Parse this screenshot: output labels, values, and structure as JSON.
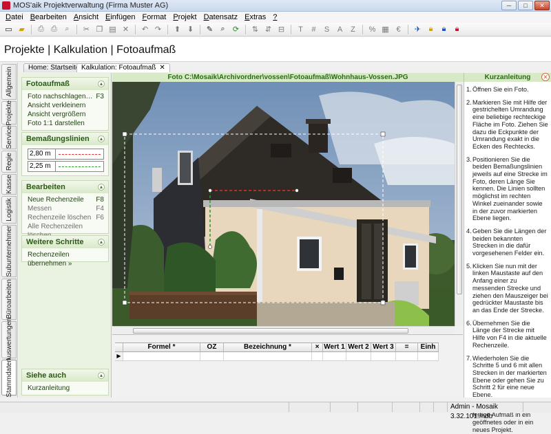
{
  "window": {
    "title": "MOS'aik Projektverwaltung (Firma Muster AG)"
  },
  "menu": [
    {
      "label": "Datei",
      "u": "D",
      "rest": "atei"
    },
    {
      "label": "Bearbeiten",
      "u": "B",
      "rest": "earbeiten"
    },
    {
      "label": "Ansicht",
      "u": "A",
      "rest": "nsicht"
    },
    {
      "label": "Einfügen",
      "u": "E",
      "rest": "infügen"
    },
    {
      "label": "Format",
      "u": "F",
      "rest": "ormat"
    },
    {
      "label": "Projekt",
      "u": "P",
      "rest": "rojekt"
    },
    {
      "label": "Datensatz",
      "u": "D",
      "rest": "atensatz"
    },
    {
      "label": "Extras",
      "u": "E",
      "rest": "xtras"
    },
    {
      "label": "?",
      "u": "?",
      "rest": ""
    }
  ],
  "header": {
    "title": "Projekte | Kalkulation | Fotoaufmaß"
  },
  "vtabs": [
    "Allgemein",
    "Projekte",
    "Service",
    "Regie",
    "Kasse",
    "Logistik",
    "Subunternehmer",
    "Büroarbeiten",
    "Auswertungen",
    "Stammdaten"
  ],
  "doc_tabs": [
    "Home: Startseite",
    "Kalkulation: Fotoaufmaß"
  ],
  "panels": {
    "fotoaufmass": {
      "title": "Fotoaufmaß",
      "items": [
        {
          "label": "Foto nachschlagen…",
          "key": "F3"
        },
        {
          "label": "Ansicht verkleinern",
          "key": ""
        },
        {
          "label": "Ansicht vergrößern",
          "key": ""
        },
        {
          "label": "Foto 1:1 darstellen",
          "key": ""
        }
      ]
    },
    "bemassung": {
      "title": "Bemaßungslinien",
      "lines": [
        {
          "value": "2,80 m",
          "color": "#e0302a"
        },
        {
          "value": "2,25 m",
          "color": "#2a9a2a"
        }
      ]
    },
    "bearbeiten": {
      "title": "Bearbeiten",
      "items": [
        {
          "label": "Neue Rechenzeile",
          "key": "F8",
          "enabled": true
        },
        {
          "label": "Messen",
          "key": "F4",
          "enabled": false
        },
        {
          "label": "Rechenzeile löschen",
          "key": "F6",
          "enabled": false
        },
        {
          "label": "Alle Rechenzeilen löschen",
          "key": "",
          "enabled": false
        }
      ]
    },
    "weitere": {
      "title": "Weitere Schritte",
      "items": [
        {
          "label": "Rechenzeilen übernehmen »",
          "key": ""
        }
      ]
    },
    "siehe": {
      "title": "Siehe auch",
      "items": [
        {
          "label": "Kurzanleitung",
          "key": ""
        }
      ]
    }
  },
  "photo": {
    "title": "Foto C:\\Mosaik\\Archivordner\\vossen\\Fotoaufmaß\\Wohnhaus-Vossen.JPG"
  },
  "grid": {
    "columns": [
      "Formel *",
      "OZ",
      "Bezeichnung *",
      "×",
      "Wert 1",
      "Wert 2",
      "Wert 3",
      "=",
      "Einh"
    ]
  },
  "kurzanleitung": {
    "title": "Kurzanleitung",
    "steps": [
      "Öffnen Sie ein Foto.",
      "Markieren Sie mit Hilfe der gestrichelten Umrandung eine beliebige rechteckige Fläche im Foto. Ziehen Sie dazu die Eckpunkte der Umrandung exakt in die Ecken des Rechtecks.",
      "Positionieren Sie die beiden Bemaßungslinien jeweils auf eine Strecke im Foto, deren Länge Sie kennen. Die Linien sollten möglichst im rechten Winkel zueinander sowie in der zuvor markierten Ebene liegen.",
      "Geben Sie die Längen der beiden bekannten Strecken in die dafür vorgesehenen Felder ein.",
      "Klicken Sie nun mit der linken Maustaste auf den Anfang einer zu messenden Strecke und ziehen den Mauszeiger bei gedrückter Maustaste bis an das Ende der Strecke.",
      "Übernehmen Sie die Länge der Strecke mit Hilfe von F4 in die aktuelle Rechenzeile.",
      "Wiederholen Sie die Schritte 5 und 6 mit allen Strecken in der markierten Ebene oder gehen Sie zu Schritt 2 für eine neue Ebene.",
      "Übernehmen Sie das fertige Aufmaß in ein geöffnetes oder in ein neues Projekt."
    ]
  },
  "status": {
    "text": "Admin - Mosaik 3.32.101.mdb"
  }
}
